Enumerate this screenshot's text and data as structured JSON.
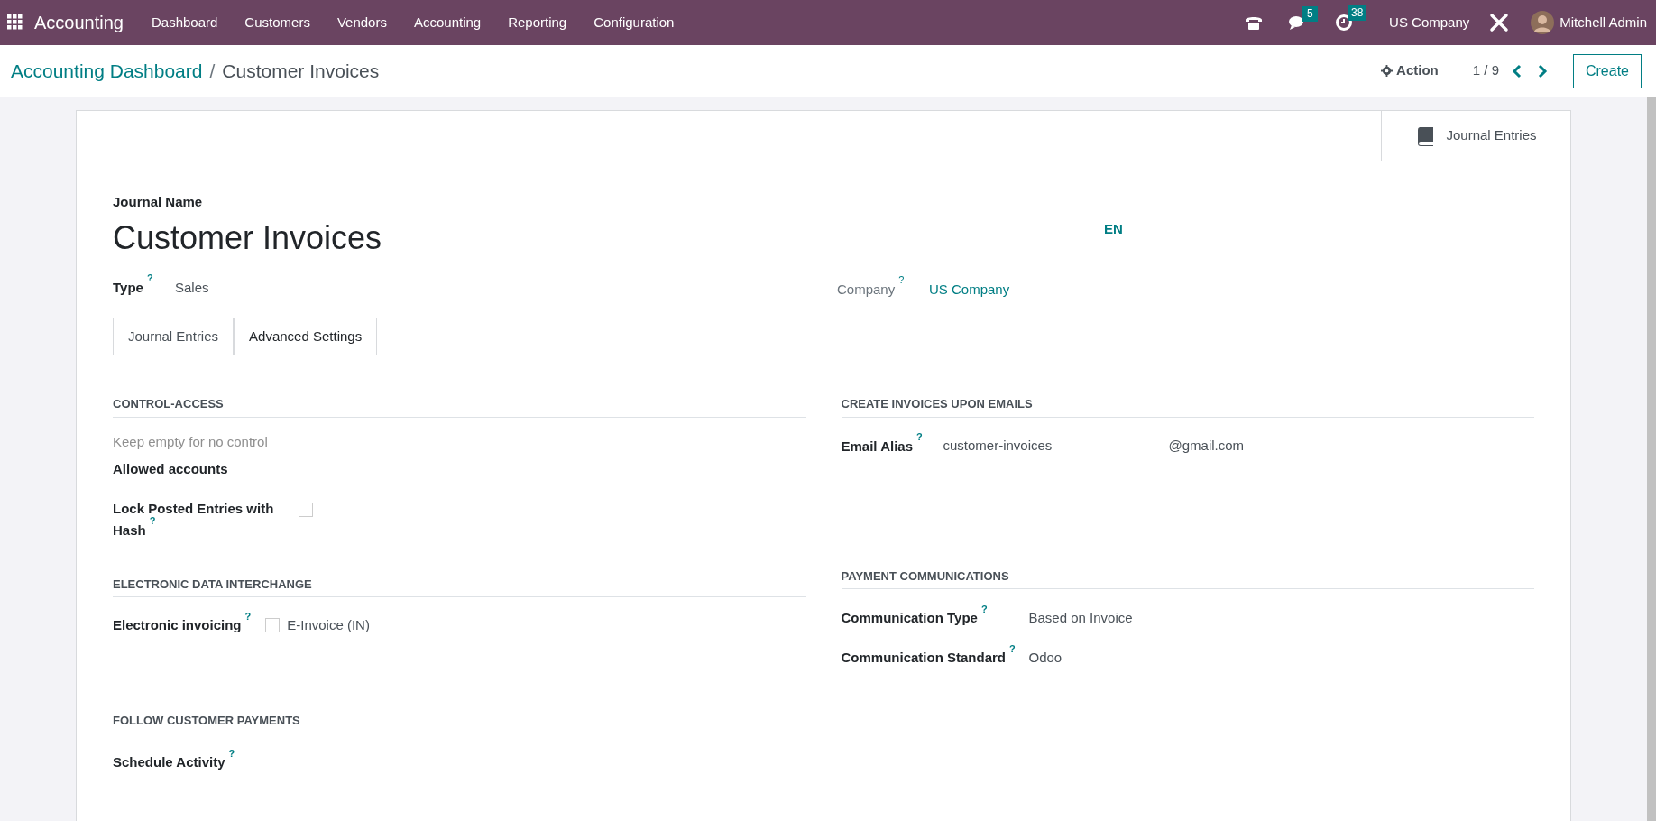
{
  "navbar": {
    "app_name": "Accounting",
    "menu": [
      "Dashboard",
      "Customers",
      "Vendors",
      "Accounting",
      "Reporting",
      "Configuration"
    ],
    "messages_count": "5",
    "activities_count": "38",
    "company": "US Company",
    "user": "Mitchell Admin"
  },
  "control_panel": {
    "breadcrumb_separator": "/",
    "breadcrumbs": [
      {
        "label": "Accounting Dashboard",
        "kind": "link"
      },
      {
        "label": "Customer Invoices",
        "kind": "current"
      }
    ],
    "action": "Action",
    "pager": "1 / 9",
    "create": "Create"
  },
  "button_box": {
    "journal_entries": "Journal Entries"
  },
  "form": {
    "name_label": "Journal Name",
    "name": "Customer Invoices",
    "language": "EN",
    "type_label": "Type",
    "type_value": "Sales",
    "company_label": "Company",
    "company_value": "US Company",
    "help_mark": "?"
  },
  "tabs": [
    {
      "label": "Journal Entries",
      "selected": false
    },
    {
      "label": "Advanced Settings",
      "selected": true
    }
  ],
  "left_sections": [
    {
      "title": "CONTROL-ACCESS",
      "fields": [
        {
          "kind": "placeholder",
          "placeholder": "Keep empty for no control",
          "label": "Allowed accounts"
        },
        {
          "kind": "checkbox",
          "label": "Lock Posted Entries with Hash",
          "help": true,
          "checked": false
        }
      ]
    },
    {
      "title": "ELECTRONIC DATA INTERCHANGE",
      "fields": [
        {
          "kind": "checkbox_option",
          "label": "Electronic invoicing",
          "help": true,
          "option": "E-Invoice (IN)",
          "checked": false
        }
      ]
    },
    {
      "title": "FOLLOW CUSTOMER PAYMENTS",
      "fields": [
        {
          "kind": "empty",
          "label": "Schedule Activity",
          "help": true
        }
      ]
    }
  ],
  "right_sections": [
    {
      "title": "CREATE INVOICES UPON EMAILS",
      "fields": [
        {
          "kind": "alias",
          "label": "Email Alias",
          "help": true,
          "value": "customer-invoices",
          "domain": "@gmail.com"
        }
      ]
    },
    {
      "title": "PAYMENT COMMUNICATIONS",
      "fields": [
        {
          "kind": "text",
          "label": "Communication Type",
          "help": true,
          "value": "Based on Invoice"
        },
        {
          "kind": "text",
          "label": "Communication Standard",
          "help": true,
          "value": "Odoo"
        }
      ]
    }
  ]
}
